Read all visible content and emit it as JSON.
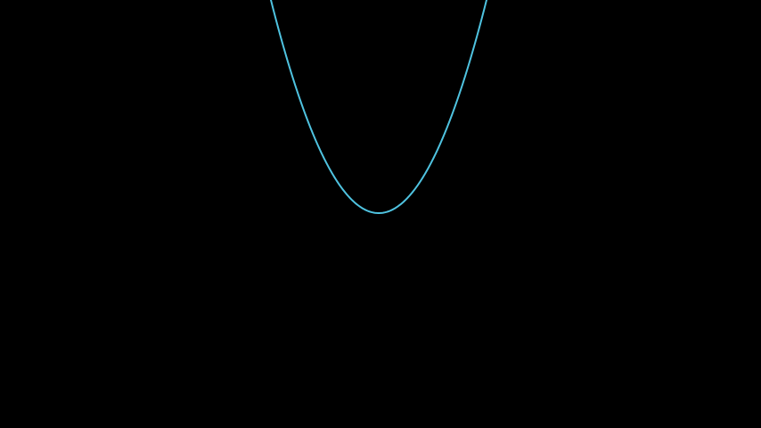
{
  "scene": {
    "background_color": "#000000",
    "curve": {
      "shape": "parabola",
      "opens": "upward",
      "stroke_color": "#4fc3e0"
    }
  }
}
